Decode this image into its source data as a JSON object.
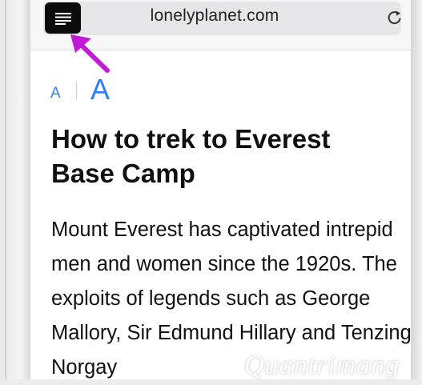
{
  "browser": {
    "url": "lonelyplanet.com",
    "reader_icon": "reader-list-icon",
    "reload_icon": "reload-icon"
  },
  "reader": {
    "font_small": "A",
    "font_large": "A"
  },
  "article": {
    "title": "How to trek to Everest Base Camp",
    "body": "Mount Everest has captivated intrepid men and women since the 1920s. The exploits of legends such as George Mallory, Sir Edmund Hillary and Tenzing Norgay"
  },
  "watermark": "Quantrimang",
  "colors": {
    "accent": "#2f7ef5",
    "annotation_arrow": "#c21bd6"
  }
}
